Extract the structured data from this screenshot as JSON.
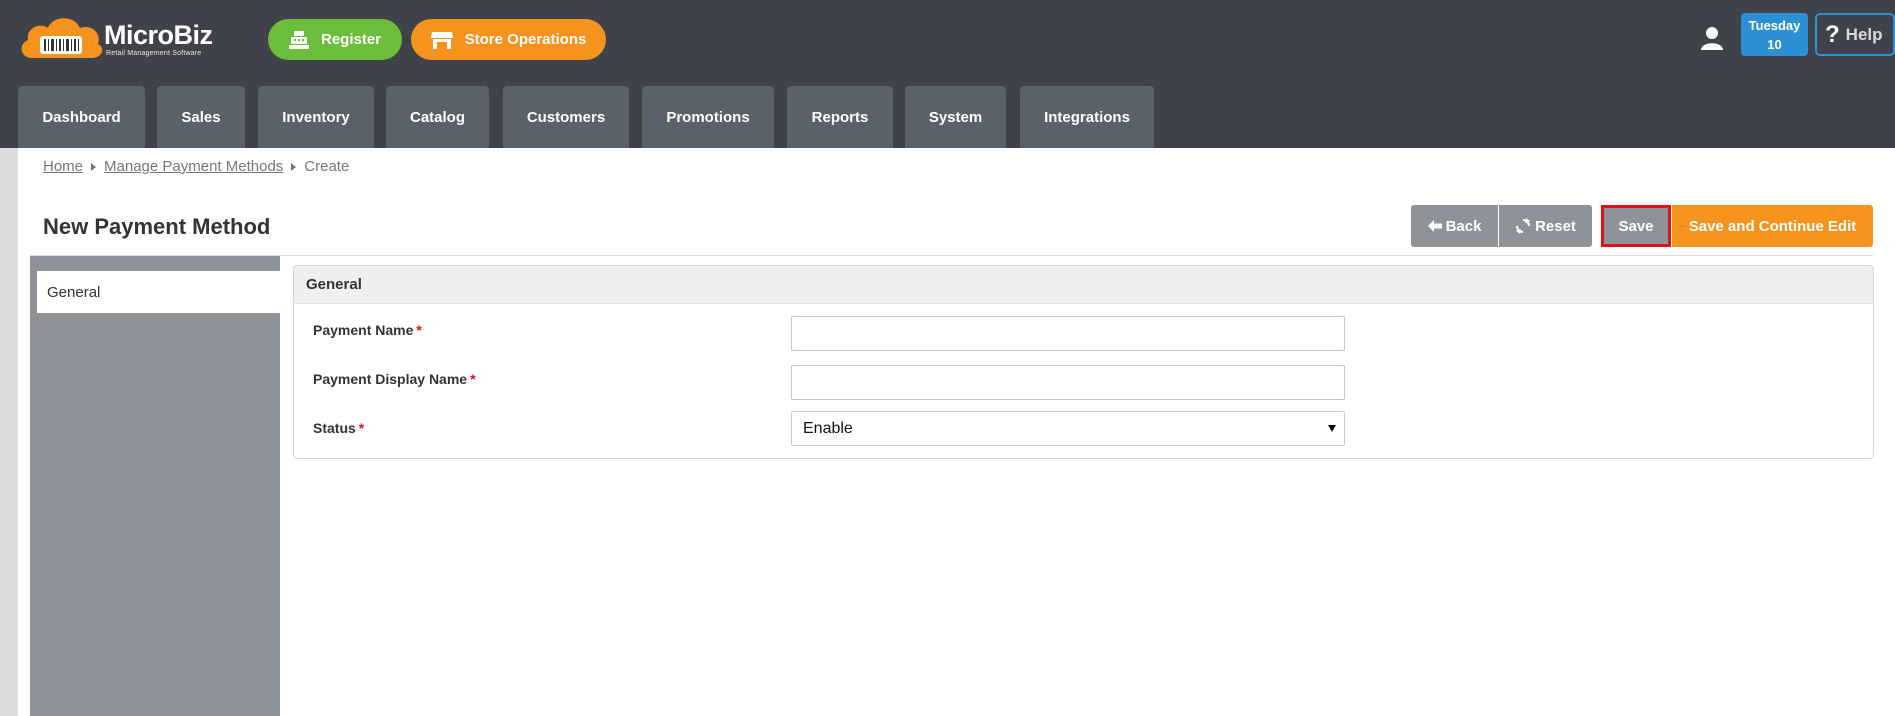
{
  "brand": {
    "name": "MicroBiz",
    "tagline": "Retail Management Software"
  },
  "header": {
    "register_label": "Register",
    "store_ops_label": "Store Operations",
    "date_day": "Tuesday",
    "date_num": "10",
    "help_label": "Help"
  },
  "nav": {
    "tabs": [
      {
        "label": "Dashboard"
      },
      {
        "label": "Sales"
      },
      {
        "label": "Inventory"
      },
      {
        "label": "Catalog"
      },
      {
        "label": "Customers"
      },
      {
        "label": "Promotions"
      },
      {
        "label": "Reports"
      },
      {
        "label": "System"
      },
      {
        "label": "Integrations"
      }
    ]
  },
  "breadcrumb": {
    "home": "Home",
    "parent": "Manage Payment Methods",
    "current": "Create"
  },
  "page": {
    "title": "New Payment Method"
  },
  "actions": {
    "back": "Back",
    "reset": "Reset",
    "save": "Save",
    "save_continue": "Save and Continue Edit"
  },
  "sidebar": {
    "items": [
      {
        "label": "General"
      }
    ]
  },
  "form": {
    "section_title": "General",
    "payment_name_label": "Payment Name",
    "payment_name_value": "",
    "display_name_label": "Payment Display Name",
    "display_name_value": "",
    "status_label": "Status",
    "status_value": "Enable",
    "required_mark": "*"
  },
  "colors": {
    "topbar": "#3f4349",
    "nav_tab": "#5b6168",
    "register_green": "#6cbd3b",
    "accent_orange": "#f6921e",
    "date_blue": "#2d8fd4",
    "gray_button": "#8e9399",
    "highlight_red": "#e0101a"
  }
}
